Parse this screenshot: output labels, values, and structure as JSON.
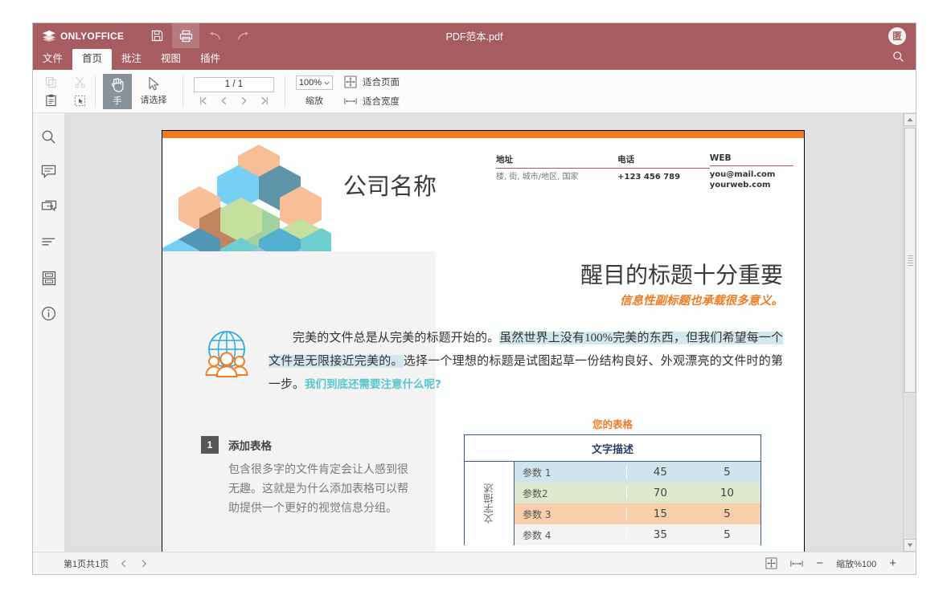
{
  "titlebar": {
    "brand": "ONLYOFFICE",
    "doc_title": "PDF范本.pdf",
    "tools": [
      {
        "name": "save-icon",
        "label": "保存"
      },
      {
        "name": "print-icon",
        "label": "打印"
      },
      {
        "name": "undo-icon",
        "label": "撤销"
      },
      {
        "name": "redo-icon",
        "label": "重做"
      }
    ],
    "avatar_initial": "匿"
  },
  "tabs": [
    {
      "label": "文件",
      "active": false
    },
    {
      "label": "首页",
      "active": true
    },
    {
      "label": "批注",
      "active": false
    },
    {
      "label": "视图",
      "active": false
    },
    {
      "label": "插件",
      "active": false
    }
  ],
  "ribbon": {
    "copy_label": "复制",
    "cut_label": "剪切",
    "paste_label": "粘贴",
    "select_all_label": "全选",
    "hand_label": "手",
    "select_label": "请选择",
    "page_value": "1 / 1",
    "nav_first": "首页",
    "nav_prev": "上一页",
    "nav_next": "下一页",
    "nav_last": "末页",
    "zoom_value": "100%",
    "zoom_label": "缩放",
    "fit_page_label": "适合页面",
    "fit_width_label": "适合宽度"
  },
  "leftbar": {
    "items": [
      {
        "name": "search-icon",
        "label": "搜索"
      },
      {
        "name": "comment-icon",
        "label": "批注"
      },
      {
        "name": "chat-icon",
        "label": "聊天"
      },
      {
        "name": "headings-icon",
        "label": "标题导航"
      },
      {
        "name": "thumbnails-icon",
        "label": "页面缩略图"
      },
      {
        "name": "info-icon",
        "label": "文档信息"
      }
    ]
  },
  "document": {
    "company_name": "公司名称",
    "contacts": [
      {
        "header": "地址",
        "value": "楼, 街, 城市/地区, 国家"
      },
      {
        "header": "电话",
        "value": "+123 456 789"
      },
      {
        "header": "WEB",
        "value": "you@mail.com",
        "value2": "yourweb.com"
      }
    ],
    "headline": "醒目的标题十分重要",
    "subhead": "信息性副标题也承载很多意义。",
    "paragraph": {
      "part1": "完美的文件总是从完美的标题开始的。",
      "highlight1": "虽然世界上没有100%完美的东西，但我们希望每一个文件是无限接近完美的。",
      "part2": "选择一个理想的标题是试图起草一份结构良好、外观漂亮的文件时的第一步。",
      "teal": "我们到底还需要注意什么呢?"
    },
    "numbered": {
      "number": "1",
      "title": "添加表格",
      "body": "包含很多字的文件肯定会让人感到很无趣。这就是为什么添加表格可以帮助提供一个更好的视觉信息分组。"
    },
    "table": {
      "title": "您的表格",
      "header": "文字描述",
      "side_label": "文字描述",
      "rows": [
        {
          "name": "参数 1",
          "v1": "45",
          "v2": "5",
          "color": "#cfe4ec"
        },
        {
          "name": "参数2",
          "v1": "70",
          "v2": "10",
          "color": "#dfe8cd"
        },
        {
          "name": "参数 3",
          "v1": "15",
          "v2": "5",
          "color": "#f8cfab"
        },
        {
          "name": "参数 4",
          "v1": "35",
          "v2": "5",
          "color": "#f3f3f3"
        }
      ]
    }
  },
  "statusbar": {
    "page_info": "第1页共1页",
    "prev_label": "上一页",
    "next_label": "下一页",
    "fit_page_label": "适合页面",
    "fit_width_label": "适合宽度",
    "zoom_out_label": "−",
    "zoom_label": "缩放%100",
    "zoom_in_label": "+"
  },
  "colors": {
    "brand": "#a75c61",
    "accent_orange": "#f47b20",
    "table_border": "#3f5a8f",
    "teal": "#57c7cd"
  }
}
